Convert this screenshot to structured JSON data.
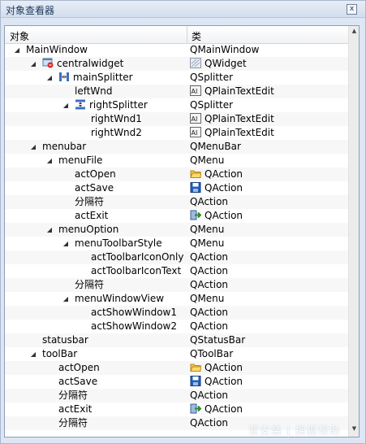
{
  "panel": {
    "title": "对象查看器",
    "close_symbol": "x"
  },
  "tree": {
    "columns": [
      "对象",
      "类"
    ],
    "rows": [
      {
        "name": "MainWindow",
        "class": "QMainWindow",
        "level": 0,
        "expanded": true,
        "obj_icon": "",
        "cls_icon": ""
      },
      {
        "name": "centralwidget",
        "class": "QWidget",
        "level": 1,
        "expanded": true,
        "obj_icon": "widget-icon",
        "cls_icon": "qwidget-icon"
      },
      {
        "name": "mainSplitter",
        "class": "QSplitter",
        "level": 2,
        "expanded": true,
        "obj_icon": "hsplitter-icon",
        "cls_icon": ""
      },
      {
        "name": "leftWnd",
        "class": "QPlainTextEdit",
        "level": 3,
        "expanded": null,
        "obj_icon": "",
        "cls_icon": "textedit-icon"
      },
      {
        "name": "rightSplitter",
        "class": "QSplitter",
        "level": 3,
        "expanded": true,
        "obj_icon": "vsplitter-icon",
        "cls_icon": ""
      },
      {
        "name": "rightWnd1",
        "class": "QPlainTextEdit",
        "level": 4,
        "expanded": null,
        "obj_icon": "",
        "cls_icon": "textedit-icon"
      },
      {
        "name": "rightWnd2",
        "class": "QPlainTextEdit",
        "level": 4,
        "expanded": null,
        "obj_icon": "",
        "cls_icon": "textedit-icon"
      },
      {
        "name": "menubar",
        "class": "QMenuBar",
        "level": 1,
        "expanded": true,
        "obj_icon": "",
        "cls_icon": ""
      },
      {
        "name": "menuFile",
        "class": "QMenu",
        "level": 2,
        "expanded": true,
        "obj_icon": "",
        "cls_icon": ""
      },
      {
        "name": "actOpen",
        "class": "QAction",
        "level": 3,
        "expanded": null,
        "obj_icon": "",
        "cls_icon": "folder-icon"
      },
      {
        "name": "actSave",
        "class": "QAction",
        "level": 3,
        "expanded": null,
        "obj_icon": "",
        "cls_icon": "save-icon"
      },
      {
        "name": "分隔符",
        "class": "QAction",
        "level": 3,
        "expanded": null,
        "obj_icon": "",
        "cls_icon": ""
      },
      {
        "name": "actExit",
        "class": "QAction",
        "level": 3,
        "expanded": null,
        "obj_icon": "",
        "cls_icon": "exit-icon"
      },
      {
        "name": "menuOption",
        "class": "QMenu",
        "level": 2,
        "expanded": true,
        "obj_icon": "",
        "cls_icon": ""
      },
      {
        "name": "menuToolbarStyle",
        "class": "QMenu",
        "level": 3,
        "expanded": true,
        "obj_icon": "",
        "cls_icon": ""
      },
      {
        "name": "actToolbarIconOnly",
        "class": "QAction",
        "level": 4,
        "expanded": null,
        "obj_icon": "",
        "cls_icon": ""
      },
      {
        "name": "actToolbarIconText",
        "class": "QAction",
        "level": 4,
        "expanded": null,
        "obj_icon": "",
        "cls_icon": ""
      },
      {
        "name": "分隔符",
        "class": "QAction",
        "level": 3,
        "expanded": null,
        "obj_icon": "",
        "cls_icon": ""
      },
      {
        "name": "menuWindowView",
        "class": "QMenu",
        "level": 3,
        "expanded": true,
        "obj_icon": "",
        "cls_icon": ""
      },
      {
        "name": "actShowWindow1",
        "class": "QAction",
        "level": 4,
        "expanded": null,
        "obj_icon": "",
        "cls_icon": ""
      },
      {
        "name": "actShowWindow2",
        "class": "QAction",
        "level": 4,
        "expanded": null,
        "obj_icon": "",
        "cls_icon": ""
      },
      {
        "name": "statusbar",
        "class": "QStatusBar",
        "level": 1,
        "expanded": null,
        "obj_icon": "",
        "cls_icon": ""
      },
      {
        "name": "toolBar",
        "class": "QToolBar",
        "level": 1,
        "expanded": true,
        "obj_icon": "",
        "cls_icon": ""
      },
      {
        "name": "actOpen",
        "class": "QAction",
        "level": 2,
        "expanded": null,
        "obj_icon": "",
        "cls_icon": "folder-icon"
      },
      {
        "name": "actSave",
        "class": "QAction",
        "level": 2,
        "expanded": null,
        "obj_icon": "",
        "cls_icon": "save-icon"
      },
      {
        "name": "分隔符",
        "class": "QAction",
        "level": 2,
        "expanded": null,
        "obj_icon": "",
        "cls_icon": ""
      },
      {
        "name": "actExit",
        "class": "QAction",
        "level": 2,
        "expanded": null,
        "obj_icon": "",
        "cls_icon": "exit-icon"
      },
      {
        "name": "分隔符",
        "class": "QAction",
        "level": 2,
        "expanded": null,
        "obj_icon": "",
        "cls_icon": ""
      }
    ]
  },
  "watermark": "亚安装 | 搜狐帮助",
  "colors": {
    "panel_bg": "#dce6f4",
    "title_text": "#1e395b",
    "row_alt": "#f7f7f7"
  }
}
